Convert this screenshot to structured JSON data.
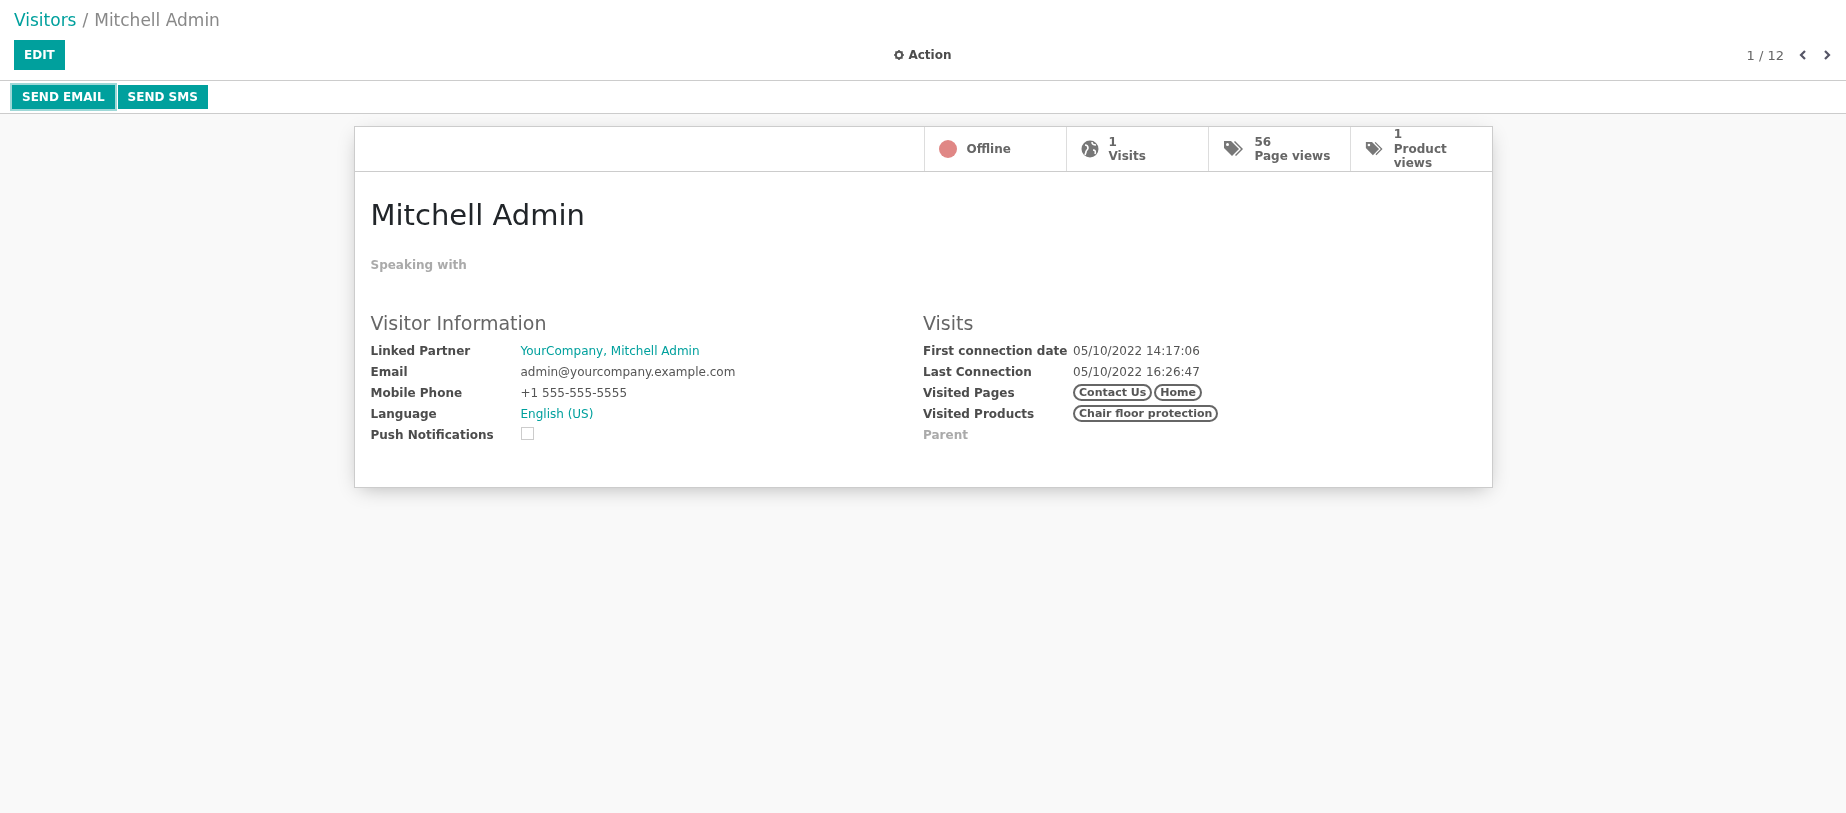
{
  "breadcrumb": {
    "parent": "Visitors",
    "separator": "/",
    "current": "Mitchell Admin"
  },
  "control_panel": {
    "edit_button": "EDIT",
    "action": "Action",
    "pager": "1 / 12"
  },
  "header_buttons": [
    {
      "label": "SEND EMAIL",
      "focused": true
    },
    {
      "label": "SEND SMS",
      "focused": false
    }
  ],
  "stat_buttons": [
    {
      "kind": "status",
      "label": "Offline",
      "color": "#e08785"
    },
    {
      "kind": "globe",
      "value": "1",
      "label": "Visits"
    },
    {
      "kind": "tags",
      "value": "56",
      "label": "Page views"
    },
    {
      "kind": "tags",
      "value": "1",
      "label": "Product views"
    }
  ],
  "title": "Mitchell Admin",
  "speaking_with": "Speaking with",
  "groups": [
    {
      "title": "Visitor Information",
      "fields": [
        {
          "label": "Linked Partner",
          "kind": "link",
          "value": "YourCompany, Mitchell Admin"
        },
        {
          "label": "Email",
          "kind": "text",
          "value": "admin@yourcompany.example.com"
        },
        {
          "label": "Mobile Phone",
          "kind": "text",
          "value": "+1 555-555-5555"
        },
        {
          "label": "Language",
          "kind": "link",
          "value": "English (US)"
        },
        {
          "label": "Push Notifications",
          "kind": "checkbox",
          "checked": false
        }
      ]
    },
    {
      "title": "Visits",
      "fields": [
        {
          "label": "First connection date",
          "kind": "text",
          "value": "05/10/2022 14:17:06"
        },
        {
          "label": "Last Connection",
          "kind": "text",
          "value": "05/10/2022 16:26:47"
        },
        {
          "label": "Visited Pages",
          "kind": "tags",
          "tags": [
            "Contact Us",
            "Home"
          ]
        },
        {
          "label": "Visited Products",
          "kind": "tags",
          "tags": [
            "Chair floor protection"
          ]
        },
        {
          "label": "Parent",
          "kind": "empty"
        }
      ]
    }
  ]
}
